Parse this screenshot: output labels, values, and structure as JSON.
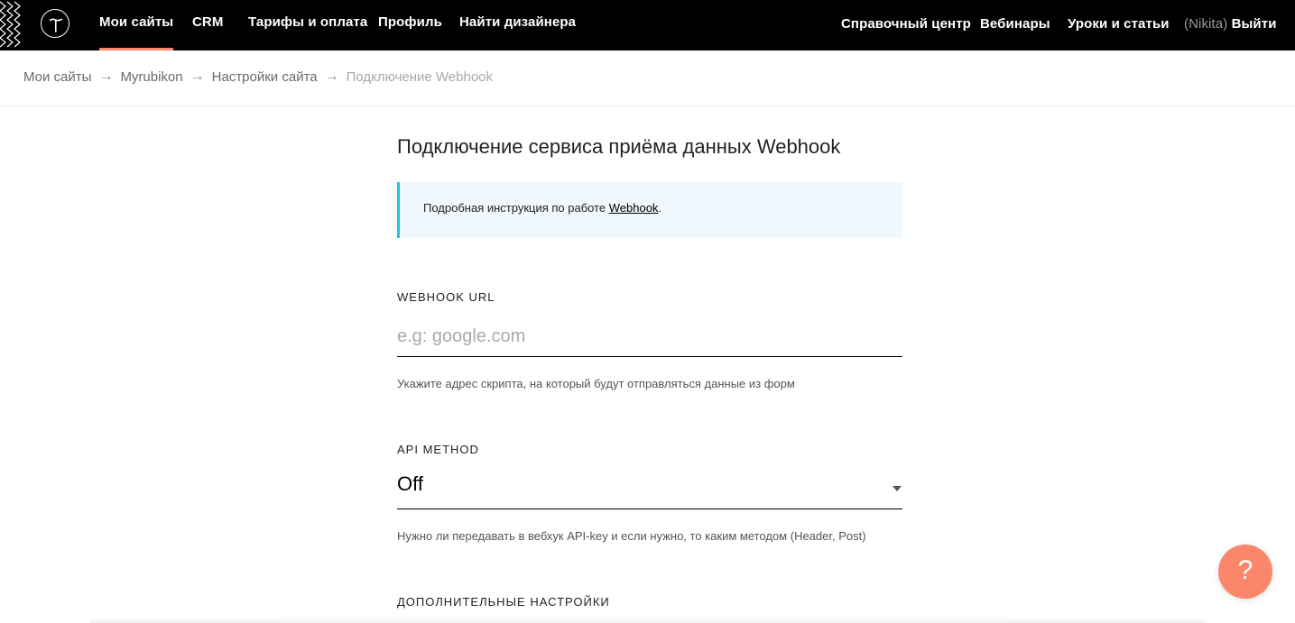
{
  "colors": {
    "topbar_bg": "#000000",
    "active_underline": "#fa876b",
    "info_border": "#26c4e0",
    "info_bg": "#f0f7fd",
    "help_button": "#fa876b"
  },
  "topnav": {
    "logo_icon": "tilda-t-logo-icon",
    "left_items": [
      "Мои сайты",
      "CRM",
      "Тарифы и оплата",
      "Профиль",
      "Найти дизайнера"
    ],
    "active_item": "Мои сайты",
    "right_items": [
      "Справочный центр",
      "Вебинары",
      "Уроки и статьи"
    ],
    "user_name": "(Nikita)",
    "logout_label": "Выйти"
  },
  "breadcrumb": {
    "items": [
      "Мои сайты",
      "Myrubikon",
      "Настройки сайта"
    ],
    "separator": "→",
    "current": "Подключение Webhook"
  },
  "main": {
    "title": "Подключение сервиса приёма данных Webhook",
    "info": {
      "text_before": "Подробная инструкция по работе ",
      "link_text": "Webhook",
      "text_after": "."
    },
    "webhook_url": {
      "label": "WEBHOOK URL",
      "value": "",
      "placeholder": "e.g: google.com",
      "hint": "Укажите адрес скрипта, на который будут отправляться данные из форм"
    },
    "api_method": {
      "label": "API METHOD",
      "selected": "Off",
      "hint": "Нужно ли передавать в вебхук API-key и если нужно, то каким методом (Header, Post)"
    },
    "extra_settings_label": "ДОПОЛНИТЕЛЬНЫЕ НАСТРОЙКИ"
  },
  "help": {
    "icon": "question-mark-icon",
    "glyph": "?"
  }
}
